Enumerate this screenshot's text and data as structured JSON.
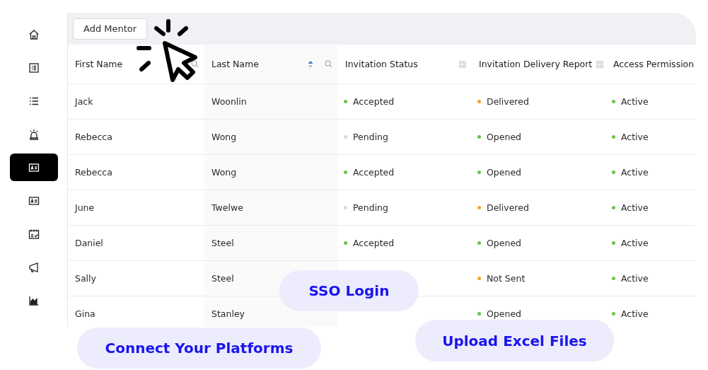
{
  "sidebar": {
    "items": [
      {
        "selected": false
      },
      {
        "selected": false
      },
      {
        "selected": false
      },
      {
        "selected": false
      },
      {
        "selected": true
      },
      {
        "selected": false
      },
      {
        "selected": false
      },
      {
        "selected": false
      },
      {
        "selected": false
      }
    ]
  },
  "toolbar": {
    "button": "Add Mentor"
  },
  "table": {
    "columns": [
      {
        "label": "First Name",
        "kind": "search"
      },
      {
        "label": "Last Name",
        "kind": "sort-search",
        "sort_ascending": true
      },
      {
        "label": "Invitation Status",
        "kind": "grid"
      },
      {
        "label": "Invitation Delivery Report",
        "kind": "grid"
      },
      {
        "label": "Access Permission",
        "kind": "plain"
      }
    ],
    "rows": [
      {
        "first_name": "Jack",
        "last_name": "Woonlin",
        "status": {
          "text": "Accepted",
          "color": "#6cc24a"
        },
        "delivery": {
          "text": "Delivered",
          "color": "#f5a623"
        },
        "access": {
          "text": "Active",
          "color": "#6cc24a"
        }
      },
      {
        "first_name": "Rebecca",
        "last_name": "Wong",
        "status": {
          "text": "Pending",
          "color": "#d9d9d9"
        },
        "delivery": {
          "text": "Opened",
          "color": "#6cc24a"
        },
        "access": {
          "text": "Active",
          "color": "#6cc24a"
        }
      },
      {
        "first_name": "Rebecca",
        "last_name": "Wong",
        "status": {
          "text": "Accepted",
          "color": "#6cc24a"
        },
        "delivery": {
          "text": "Opened",
          "color": "#6cc24a"
        },
        "access": {
          "text": "Active",
          "color": "#6cc24a"
        }
      },
      {
        "first_name": "June",
        "last_name": "Twelwe",
        "status": {
          "text": "Pending",
          "color": "#d9d9d9"
        },
        "delivery": {
          "text": "Delivered",
          "color": "#f5a623"
        },
        "access": {
          "text": "Active",
          "color": "#6cc24a"
        }
      },
      {
        "first_name": "Daniel",
        "last_name": "Steel",
        "status": {
          "text": "Accepted",
          "color": "#6cc24a"
        },
        "delivery": {
          "text": "Opened",
          "color": "#6cc24a"
        },
        "access": {
          "text": "Active",
          "color": "#6cc24a"
        }
      },
      {
        "first_name": "Sally",
        "last_name": "Steel",
        "delivery": {
          "text": "Not Sent",
          "color": "#f5a623"
        },
        "access": {
          "text": "Active",
          "color": "#6cc24a"
        }
      },
      {
        "first_name": "Gina",
        "last_name": "Stanley",
        "delivery": {
          "text": "Opened",
          "color": "#6cc24a"
        },
        "access": {
          "text": "Active",
          "color": "#6cc24a"
        }
      }
    ]
  },
  "callouts": [
    {
      "text": "SSO Login"
    },
    {
      "text": "Connect Your Platforms"
    },
    {
      "text": "Upload Excel Files"
    }
  ]
}
